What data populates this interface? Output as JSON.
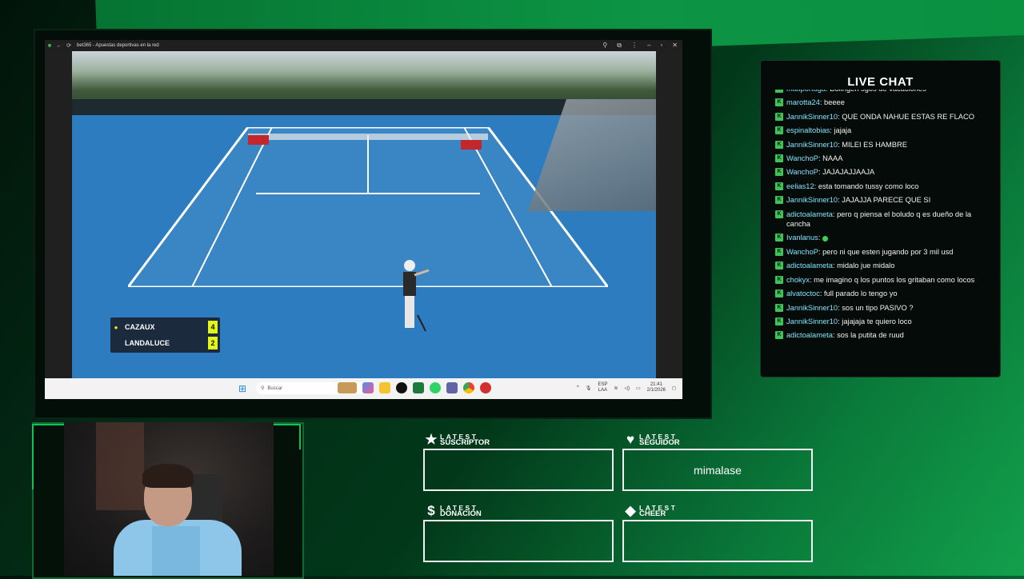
{
  "browser": {
    "title": "bet365 - Apuestas deportivas en la red"
  },
  "scoreboard": {
    "players": [
      {
        "name": "CAZAUX",
        "score": "4",
        "serving": true
      },
      {
        "name": "LANDALUCE",
        "score": "2",
        "serving": false
      }
    ]
  },
  "taskbar": {
    "search_placeholder": "Buscar",
    "lang_top": "ESP",
    "lang_bottom": "LAA",
    "time": "21:41",
    "date": "2/1/2026"
  },
  "chat": {
    "title": "LIVE CHAT",
    "messages": [
      {
        "user": "matiportuga",
        "text": "Bolingen sgos de vacaciones",
        "cut": true
      },
      {
        "user": "marotta24",
        "text": "beeee"
      },
      {
        "user": "JannikSinner10",
        "text": "QUE ONDA NAHUE ESTAS RE FLACO"
      },
      {
        "user": "espinaltobias",
        "text": "jajaja"
      },
      {
        "user": "JannikSinner10",
        "text": "MILEI ES HAMBRE"
      },
      {
        "user": "WanchoP",
        "text": "NAAA"
      },
      {
        "user": "WanchoP",
        "text": "JAJAJAJJAAJA"
      },
      {
        "user": "eelias12",
        "text": "esta tomando tussy como loco"
      },
      {
        "user": "JannikSinner10",
        "text": "JAJAJJA PARECE QUE SI"
      },
      {
        "user": "adictoalameta",
        "text": "pero q piensa el boludo q es dueño de la cancha"
      },
      {
        "user": "Ivanlanus",
        "text": "",
        "emote": true
      },
      {
        "user": "WanchoP",
        "text": "pero ni que esten jugando por 3 mil usd"
      },
      {
        "user": "adictoalameta",
        "text": "midalo jue midalo"
      },
      {
        "user": "chokyx",
        "text": "me imagino q los puntos los gritaban como locos"
      },
      {
        "user": "alvatoctoc",
        "text": "full parado lo tengo yo"
      },
      {
        "user": "JannikSinner10",
        "text": "sos un tipo PASIVO ?"
      },
      {
        "user": "JannikSinner10",
        "text": "jajajaja te quiero loco"
      },
      {
        "user": "adictoalameta",
        "text": "sos la putita de ruud"
      }
    ]
  },
  "latest": {
    "suscriptor": {
      "top": "LATEST",
      "bottom": "SUSCRIPTOR",
      "value": "",
      "icon": "star-icon"
    },
    "seguidor": {
      "top": "LATEST",
      "bottom": "SEGUIDOR",
      "value": "mimalase",
      "icon": "heart-icon"
    },
    "donacion": {
      "top": "LATEST",
      "bottom": "DONACIÓN",
      "value": "",
      "icon": "dollar-icon"
    },
    "cheer": {
      "top": "LATEST",
      "bottom": "CHEER",
      "value": "",
      "icon": "diamond-icon"
    }
  },
  "colors": {
    "accent_green": "#12c058",
    "chat_username": "#7fe3ff",
    "score_highlight": "#e3f51b"
  }
}
